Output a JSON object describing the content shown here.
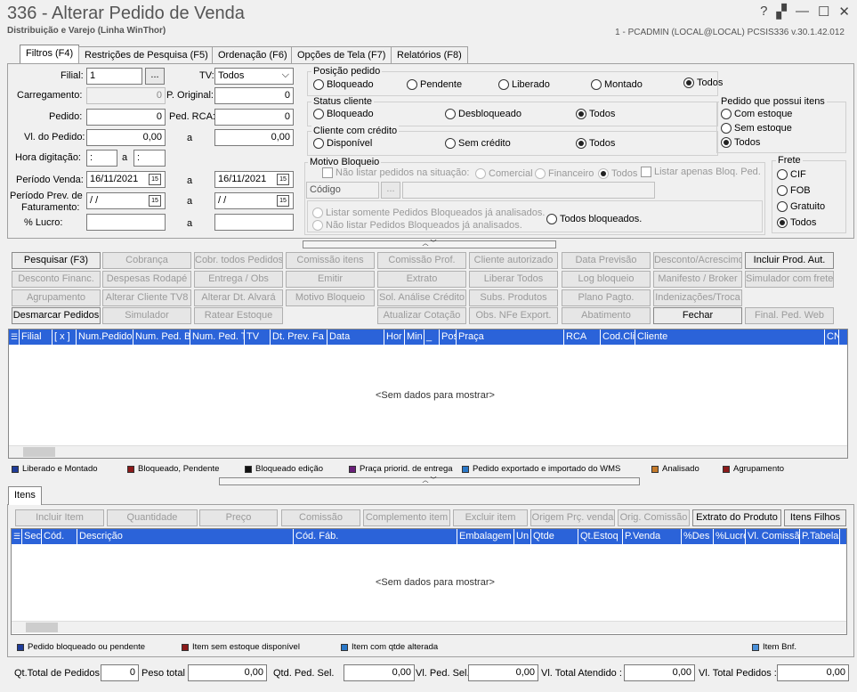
{
  "window": {
    "title": "336 - Alterar Pedido de Venda",
    "subtitle": "Distribuição e Varejo (Linha WinThor)",
    "system_info": "1 - PCADMIN (LOCAL@LOCAL)   PCSIS336  v.30.1.42.012",
    "help": "?",
    "restore": "▞",
    "minimize": "—",
    "maximize": "☐",
    "close": "✕"
  },
  "tabs": [
    "Filtros (F4)",
    "Restrições de Pesquisa (F5)",
    "Ordenação (F6)",
    "Opções de Tela (F7)",
    "Relatórios (F8)"
  ],
  "filters": {
    "filial_label": "Filial:",
    "filial_value": "1",
    "ellipsis": "...",
    "tv_label": "TV:",
    "tv_value": "Todos",
    "tv_arrow": "⌵",
    "carregamento_label": "Carregamento:",
    "carregamento_value": "0",
    "p_original_label": "P. Original:",
    "p_original_value": "0",
    "pedido_label": "Pedido:",
    "pedido_value": "0",
    "ped_rca_label": "Ped. RCA:",
    "ped_rca_value": "0",
    "vl_pedido_label": "Vl. do Pedido:",
    "vl_pedido_from": "0,00",
    "vl_pedido_to": "0,00",
    "a": "a",
    "hora_label": "Hora digitação:",
    "hora_from": ":",
    "hora_to": ":",
    "periodo_venda_label": "Período Venda:",
    "periodo_venda_from": "16/11/2021",
    "periodo_venda_to": "16/11/2021",
    "periodo_prev_label1": "Período Prev. de",
    "periodo_prev_label2": "Faturamento:",
    "periodo_prev_from": " / /",
    "periodo_prev_to": " / /",
    "lucro_label": "% Lucro:",
    "cal_icon": "15"
  },
  "posicao": {
    "title": "Posição pedido",
    "options": [
      "Bloqueado",
      "Pendente",
      "Liberado",
      "Montado",
      "Todos"
    ],
    "selected": "Todos"
  },
  "status_cliente": {
    "title": "Status cliente",
    "options": [
      "Bloqueado",
      "Desbloqueado",
      "Todos"
    ]
  },
  "cliente_credito": {
    "title": "Cliente com crédito",
    "options": [
      "Disponível",
      "Sem crédito",
      "Todos"
    ]
  },
  "pedido_itens": {
    "title": "Pedido que possui itens",
    "options": [
      "Com estoque",
      "Sem estoque",
      "Todos"
    ]
  },
  "frete": {
    "title": "Frete",
    "options": [
      "CIF",
      "FOB",
      "Gratuito",
      "Todos"
    ]
  },
  "motivo": {
    "title": "Motivo Bloqueio",
    "nao_listar": "Não listar pedidos na situação:",
    "comercial": "Comercial",
    "financeiro": "Financeiro",
    "todos": "Todos",
    "listar_apenas": "Listar apenas Bloq. Ped.",
    "codigo": "Código",
    "ellipsis": "...",
    "listar_analisados": "Listar somente Pedidos Bloqueados já analisados.",
    "nao_listar_analisados": "Não listar Pedidos Bloqueados já analisados.",
    "todos_bloqueados": "Todos bloqueados."
  },
  "splitter": "︿ ﹀",
  "actions": [
    [
      "Pesquisar (F3)",
      "Cobrança",
      "Cobr. todos Pedidos",
      "Comissão itens",
      "Comissão Prof.",
      "Cliente autorizado",
      "Data Previsão",
      "Desconto/Acrescimo",
      "Incluir Prod. Aut."
    ],
    [
      "Desconto Financ.",
      "Despesas Rodapé",
      "Entrega / Obs",
      "Emitir",
      "Extrato",
      "Liberar Todos",
      "Log bloqueio",
      "Manifesto / Broker",
      "Simulador com frete"
    ],
    [
      "Agrupamento",
      "Alterar Cliente TV8",
      "Alterar Dt. Alvará",
      "Motivo Bloqueio",
      "Sol. Análise Crédito",
      "Subs. Produtos",
      "Plano Pagto.",
      "Indenizações/Troca",
      ""
    ],
    [
      "Desmarcar Pedidos",
      "Simulador",
      "Ratear Estoque",
      "",
      "Atualizar Cotação",
      "Obs. NFe Export.",
      "Abatimento",
      "Fechar",
      "Final. Ped. Web"
    ]
  ],
  "orders_grid": {
    "columns": [
      "Filial",
      "[ x ]",
      "Num.Pedido",
      "Num. Ped. B",
      "Num. Ped. T",
      "TV",
      "Dt. Prev. Fa",
      "Data",
      "Hor",
      "Min",
      "_",
      "Pos",
      "Praça",
      "RCA",
      "Cod.Cli",
      "Cliente",
      "CN"
    ],
    "empty": "<Sem dados para mostrar>"
  },
  "legend1": [
    {
      "label": "Liberado e Montado",
      "color": "#1f3c99"
    },
    {
      "label": "Bloqueado, Pendente",
      "color": "#8b1a1a"
    },
    {
      "label": "Bloqueado edição",
      "color": "#111111"
    },
    {
      "label": "Praça priorid. de entrega",
      "color": "#6a1f7a"
    },
    {
      "label": "Pedido exportado e importado do WMS",
      "color": "#2a78c8"
    },
    {
      "label": "Analisado",
      "color": "#c57a2a"
    },
    {
      "label": "Agrupamento",
      "color": "#8b1a1a"
    }
  ],
  "itens_tab": "Itens",
  "item_actions": [
    "Incluir Item",
    "Quantidade",
    "Preço",
    "Comissão",
    "Complemento item",
    "Excluir item",
    "Origem Prç. venda",
    "Orig. Comissão",
    "Extrato do Produto",
    "Itens Filhos"
  ],
  "items_grid": {
    "columns": [
      "Sec",
      "Cód.",
      "Descrição",
      "Cód. Fáb.",
      "Embalagem",
      "Un",
      "Qtde",
      "Qt.Estoq",
      "P.Venda",
      "%Des",
      "%Lucro",
      "Vl. Comissão",
      "P.Tabela"
    ],
    "empty": "<Sem dados para mostrar>"
  },
  "legend2": [
    {
      "label": "Pedido bloqueado ou pendente",
      "color": "#1f3c99"
    },
    {
      "label": "Item sem estoque disponível",
      "color": "#8b1a1a"
    },
    {
      "label": "Item com qtde alterada",
      "color": "#2a78c8"
    },
    {
      "label": "Item Bnf.",
      "color": "#4a90d9"
    }
  ],
  "totals": {
    "qt_pedidos_label": "Qt.Total de Pedidos",
    "qt_pedidos": "0",
    "peso_label": "Peso total",
    "peso": "0,00",
    "qtd_sel_label": "Qtd. Ped. Sel.",
    "qtd_sel": "0,00",
    "vl_sel_label": "Vl. Ped. Sel.",
    "vl_sel": "0,00",
    "vl_atendido_label": "Vl. Total Atendido :",
    "vl_atendido": "0,00",
    "vl_pedidos_label": "Vl. Total Pedidos :",
    "vl_pedidos": "0,00"
  }
}
